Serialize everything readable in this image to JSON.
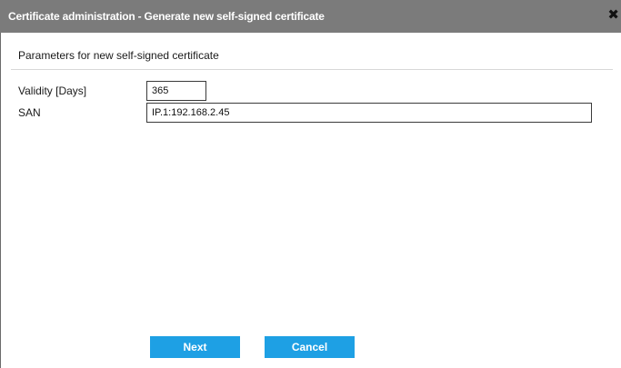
{
  "dialog": {
    "title": "Certificate administration - Generate new self-signed certificate",
    "close_symbol": "✖",
    "subtitle": "Parameters for new self-signed certificate"
  },
  "form": {
    "validity": {
      "label": "Validity [Days]",
      "value": "365"
    },
    "san": {
      "label": "SAN",
      "value": "IP.1:192.168.2.45"
    }
  },
  "buttons": {
    "next_label": "Next",
    "cancel_label": "Cancel"
  },
  "colors": {
    "titlebar": "#7b7b7b",
    "button": "#1ea0e4"
  }
}
